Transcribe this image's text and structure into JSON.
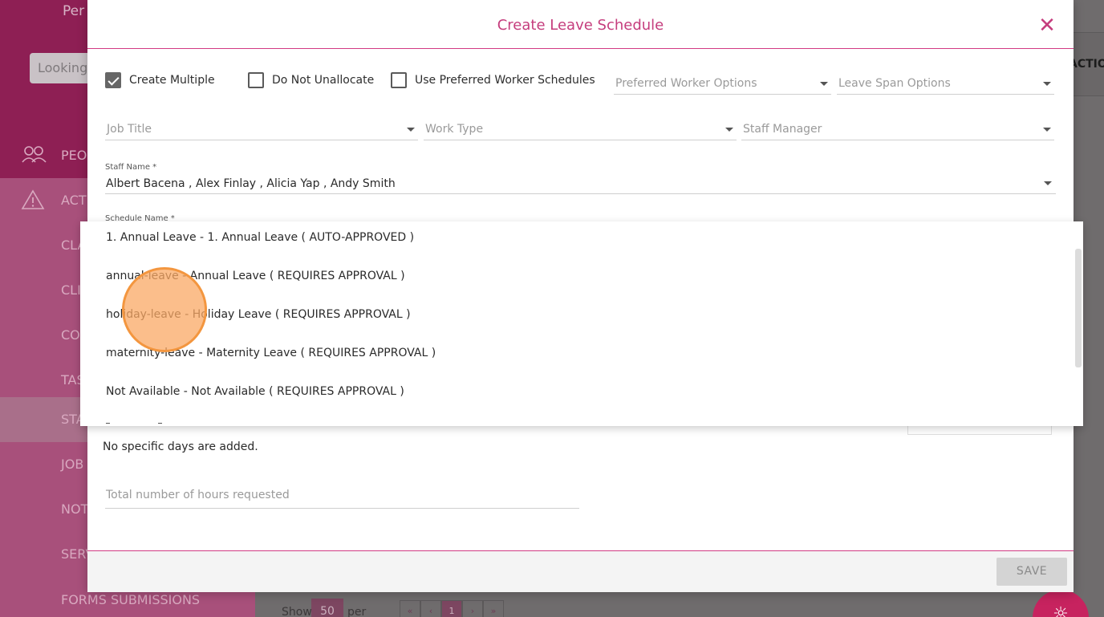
{
  "background": {
    "sidebar_title": "Per",
    "search_text": "Looking",
    "nav": [
      {
        "label": "PEO",
        "icon": "people-icon"
      },
      {
        "label": "ACTI",
        "icon": "warning-icon"
      },
      {
        "label": "CLA"
      },
      {
        "label": "CLI"
      },
      {
        "label": "CO"
      },
      {
        "label": "TAS"
      },
      {
        "label": "STA"
      },
      {
        "label": "JOB"
      },
      {
        "label": "NOT"
      },
      {
        "label": "SERV"
      },
      {
        "label": "FORMS SUBMISSIONS"
      }
    ],
    "column_header": "ACTIO",
    "pager": {
      "show_label": "Show",
      "per_page_value": "50",
      "per_page_label": "per page",
      "first": "«",
      "prev": "‹",
      "current": "1",
      "next": "›",
      "last": "»"
    }
  },
  "modal": {
    "title": "Create Leave Schedule",
    "close_symbol": "✕",
    "checkboxes": [
      {
        "label": "Create Multiple",
        "checked": true
      },
      {
        "label": "Do Not Unallocate",
        "checked": false
      },
      {
        "label": "Use Preferred Worker Schedules",
        "checked": false
      }
    ],
    "preferred_worker_options": "Preferred Worker Options",
    "leave_span_options": "Leave Span Options",
    "job_title": "Job Title",
    "work_type": "Work Type",
    "staff_manager": "Staff Manager",
    "staff_name_label": "Staff Name *",
    "staff_name_value": "Albert Bacena , Alex Finlay , Alicia Yap , Andy Smith",
    "schedule_name_label": "Schedule Name *",
    "no_days_text": "No specific days are added.",
    "hours_placeholder": "Total number of hours requested",
    "save_label": "SAVE"
  },
  "dropdown": {
    "options": [
      "1. Annual Leave - 1. Annual Leave ( AUTO-APPROVED )",
      "annual-leave - Annual Leave ( REQUIRES APPROVAL )",
      "holiday-leave - Holiday Leave ( REQUIRES APPROVAL )",
      "maternity-leave - Maternity Leave ( REQUIRES APPROVAL )",
      "Not Available - Not Available ( REQUIRES APPROVAL )"
    ]
  }
}
